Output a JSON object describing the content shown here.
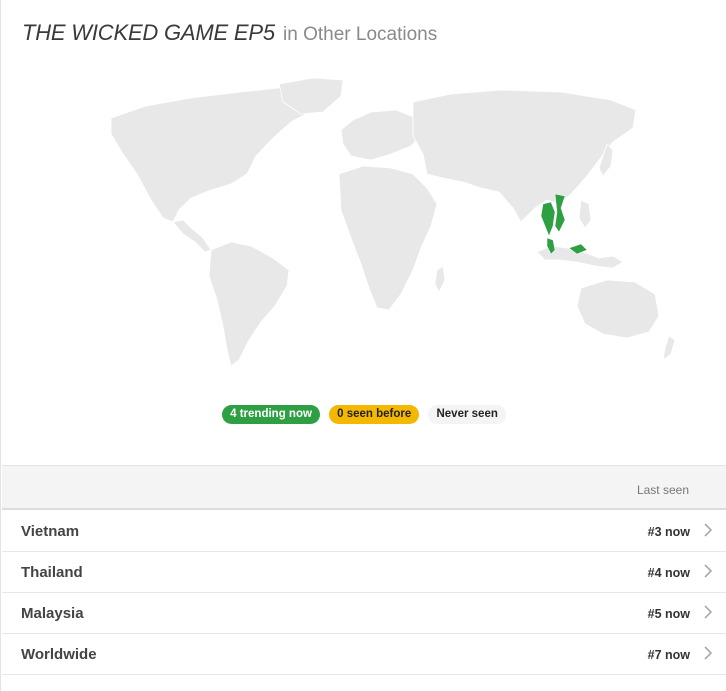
{
  "header": {
    "show_title": "THE WICKED GAME EP5",
    "title_suffix": "in Other Locations"
  },
  "legend": {
    "trending": "4 trending now",
    "seen_before": "0 seen before",
    "never_seen": "Never seen"
  },
  "colors": {
    "trending": "#2ea043",
    "seen_before": "#f5b800",
    "land": "#e8e8e8"
  },
  "table": {
    "column_header": "Last seen",
    "rows": [
      {
        "location": "Vietnam",
        "status": "#3 now"
      },
      {
        "location": "Thailand",
        "status": "#4 now"
      },
      {
        "location": "Malaysia",
        "status": "#5 now"
      },
      {
        "location": "Worldwide",
        "status": "#7 now"
      }
    ]
  }
}
